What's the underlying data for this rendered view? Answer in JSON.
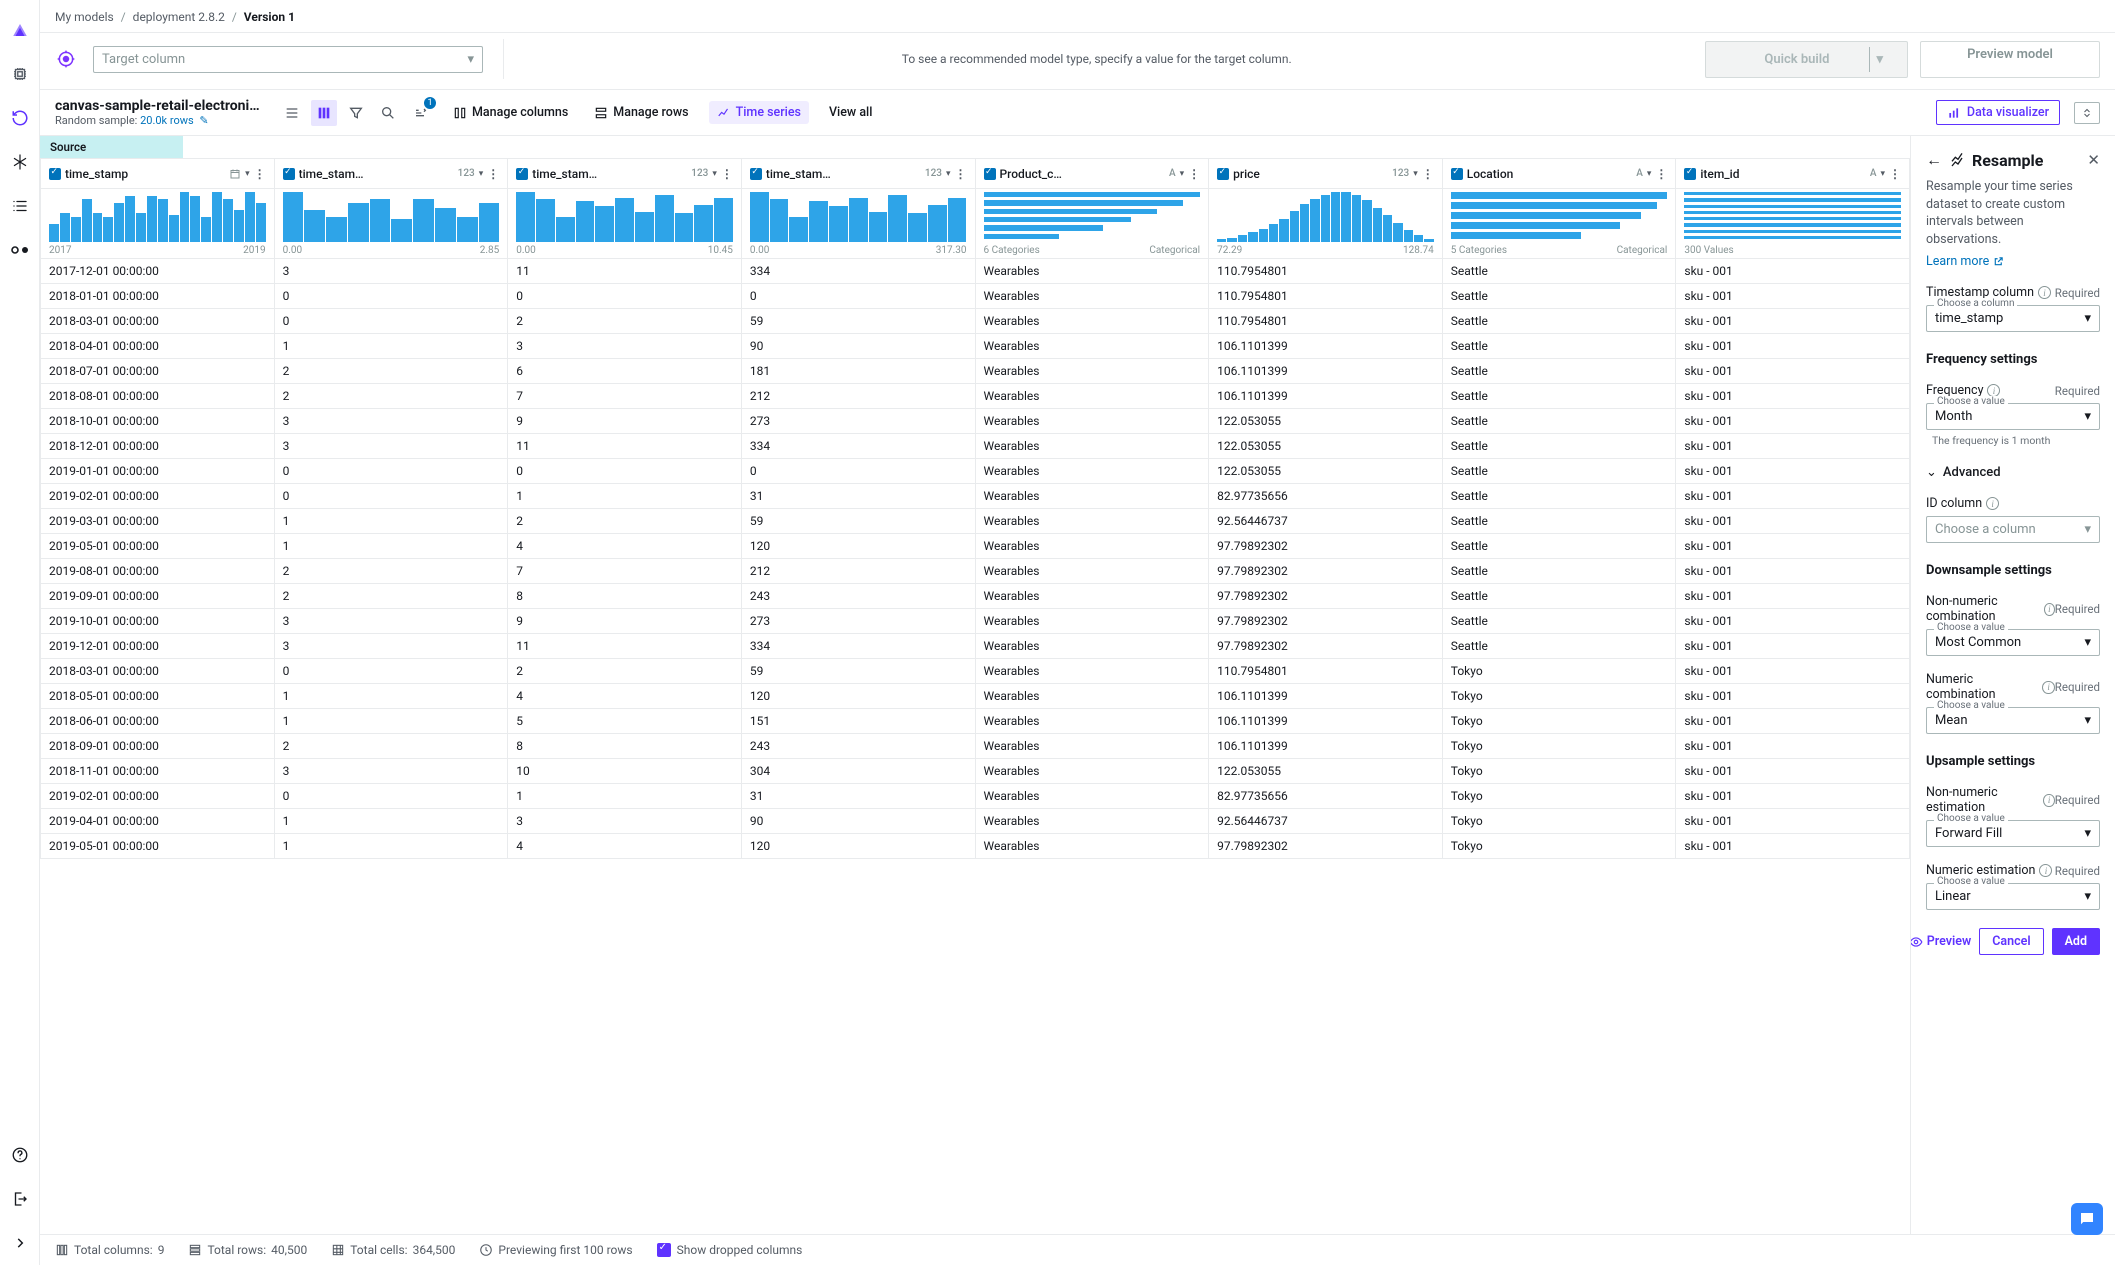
{
  "breadcrumb": {
    "parent1": "My models",
    "parent2": "deployment 2.8.2",
    "current": "Version 1"
  },
  "target": {
    "placeholder": "Target column",
    "help": "To see a recommended model type, specify a value for the target column."
  },
  "buttons": {
    "quick_build": "Quick build",
    "preview_model": "Preview model"
  },
  "dataset": {
    "name": "canvas-sample-retail-electronics-fore…",
    "sample_label": "Random sample:",
    "sample_value": "20.0k rows"
  },
  "toolbar": {
    "manage_columns": "Manage columns",
    "manage_rows": "Manage rows",
    "time_series": "Time series",
    "view_all": "View all",
    "data_visualizer": "Data visualizer",
    "badge": "1"
  },
  "source_tab": "Source",
  "columns": [
    {
      "name": "time_stamp",
      "type": "date",
      "meta_left": "2017",
      "meta_right": "2019",
      "hist": [
        25,
        40,
        35,
        60,
        40,
        35,
        55,
        65,
        40,
        65,
        60,
        38,
        70,
        65,
        35,
        70,
        60,
        45,
        70,
        55
      ]
    },
    {
      "name": "time_stam…",
      "type": "123",
      "meta_left": "0.00",
      "meta_right": "2.85",
      "hist": [
        70,
        45,
        35,
        55,
        60,
        32,
        60,
        48,
        35,
        55
      ]
    },
    {
      "name": "time_stam…",
      "type": "123",
      "meta_left": "0.00",
      "meta_right": "10.45",
      "hist": [
        70,
        60,
        35,
        58,
        50,
        62,
        42,
        66,
        40,
        52,
        62
      ]
    },
    {
      "name": "time_stam…",
      "type": "123",
      "meta_left": "0.00",
      "meta_right": "317.30",
      "hist": [
        70,
        60,
        35,
        58,
        50,
        62,
        42,
        66,
        40,
        52,
        62
      ]
    },
    {
      "name": "Product_c…",
      "type": "A",
      "meta_left": "6 Categories",
      "meta_right": "Categorical",
      "cat_bars": [
        100,
        92,
        80,
        68,
        55,
        35
      ]
    },
    {
      "name": "price",
      "type": "123",
      "meta_left": "72.29",
      "meta_right": "128.74",
      "hist": [
        5,
        8,
        12,
        18,
        24,
        32,
        42,
        55,
        68,
        78,
        85,
        90,
        90,
        85,
        75,
        62,
        48,
        35,
        22,
        12,
        6
      ]
    },
    {
      "name": "Location",
      "type": "A",
      "meta_left": "5 Categories",
      "meta_right": "Categorical",
      "cat_bars": [
        100,
        95,
        88,
        78,
        60
      ]
    },
    {
      "name": "item_id",
      "type": "A",
      "meta_left": "300 Values",
      "meta_right": "",
      "cat_bars": [
        8,
        8,
        8,
        8,
        8,
        8,
        8,
        8
      ]
    }
  ],
  "rows": [
    [
      "2017-12-01 00:00:00",
      "3",
      "11",
      "334",
      "Wearables",
      "110.7954801",
      "Seattle",
      "sku - 001"
    ],
    [
      "2018-01-01 00:00:00",
      "0",
      "0",
      "0",
      "Wearables",
      "110.7954801",
      "Seattle",
      "sku - 001"
    ],
    [
      "2018-03-01 00:00:00",
      "0",
      "2",
      "59",
      "Wearables",
      "110.7954801",
      "Seattle",
      "sku - 001"
    ],
    [
      "2018-04-01 00:00:00",
      "1",
      "3",
      "90",
      "Wearables",
      "106.1101399",
      "Seattle",
      "sku - 001"
    ],
    [
      "2018-07-01 00:00:00",
      "2",
      "6",
      "181",
      "Wearables",
      "106.1101399",
      "Seattle",
      "sku - 001"
    ],
    [
      "2018-08-01 00:00:00",
      "2",
      "7",
      "212",
      "Wearables",
      "106.1101399",
      "Seattle",
      "sku - 001"
    ],
    [
      "2018-10-01 00:00:00",
      "3",
      "9",
      "273",
      "Wearables",
      "122.053055",
      "Seattle",
      "sku - 001"
    ],
    [
      "2018-12-01 00:00:00",
      "3",
      "11",
      "334",
      "Wearables",
      "122.053055",
      "Seattle",
      "sku - 001"
    ],
    [
      "2019-01-01 00:00:00",
      "0",
      "0",
      "0",
      "Wearables",
      "122.053055",
      "Seattle",
      "sku - 001"
    ],
    [
      "2019-02-01 00:00:00",
      "0",
      "1",
      "31",
      "Wearables",
      "82.97735656",
      "Seattle",
      "sku - 001"
    ],
    [
      "2019-03-01 00:00:00",
      "1",
      "2",
      "59",
      "Wearables",
      "92.56446737",
      "Seattle",
      "sku - 001"
    ],
    [
      "2019-05-01 00:00:00",
      "1",
      "4",
      "120",
      "Wearables",
      "97.79892302",
      "Seattle",
      "sku - 001"
    ],
    [
      "2019-08-01 00:00:00",
      "2",
      "7",
      "212",
      "Wearables",
      "97.79892302",
      "Seattle",
      "sku - 001"
    ],
    [
      "2019-09-01 00:00:00",
      "2",
      "8",
      "243",
      "Wearables",
      "97.79892302",
      "Seattle",
      "sku - 001"
    ],
    [
      "2019-10-01 00:00:00",
      "3",
      "9",
      "273",
      "Wearables",
      "97.79892302",
      "Seattle",
      "sku - 001"
    ],
    [
      "2019-12-01 00:00:00",
      "3",
      "11",
      "334",
      "Wearables",
      "97.79892302",
      "Seattle",
      "sku - 001"
    ],
    [
      "2018-03-01 00:00:00",
      "0",
      "2",
      "59",
      "Wearables",
      "110.7954801",
      "Tokyo",
      "sku - 001"
    ],
    [
      "2018-05-01 00:00:00",
      "1",
      "4",
      "120",
      "Wearables",
      "106.1101399",
      "Tokyo",
      "sku - 001"
    ],
    [
      "2018-06-01 00:00:00",
      "1",
      "5",
      "151",
      "Wearables",
      "106.1101399",
      "Tokyo",
      "sku - 001"
    ],
    [
      "2018-09-01 00:00:00",
      "2",
      "8",
      "243",
      "Wearables",
      "106.1101399",
      "Tokyo",
      "sku - 001"
    ],
    [
      "2018-11-01 00:00:00",
      "3",
      "10",
      "304",
      "Wearables",
      "122.053055",
      "Tokyo",
      "sku - 001"
    ],
    [
      "2019-02-01 00:00:00",
      "0",
      "1",
      "31",
      "Wearables",
      "82.97735656",
      "Tokyo",
      "sku - 001"
    ],
    [
      "2019-04-01 00:00:00",
      "1",
      "3",
      "90",
      "Wearables",
      "92.56446737",
      "Tokyo",
      "sku - 001"
    ],
    [
      "2019-05-01 00:00:00",
      "1",
      "4",
      "120",
      "Wearables",
      "97.79892302",
      "Tokyo",
      "sku - 001"
    ]
  ],
  "footer": {
    "cols_label": "Total columns:",
    "cols_val": "9",
    "rows_label": "Total rows:",
    "rows_val": "40,500",
    "cells_label": "Total cells:",
    "cells_val": "364,500",
    "preview_label": "Previewing first 100 rows",
    "show_dropped": "Show dropped columns"
  },
  "panel": {
    "title": "Resample",
    "desc": "Resample your time series dataset to create custom intervals between observations.",
    "learn_more": "Learn more",
    "timestamp_label": "Timestamp column",
    "required": "Required",
    "choose_column": "Choose a column",
    "timestamp_value": "time_stamp",
    "freq_settings": "Frequency settings",
    "freq_label": "Frequency",
    "choose_value": "Choose a value",
    "freq_value": "Month",
    "freq_hint": "The frequency is 1 month",
    "advanced": "Advanced",
    "id_label": "ID column",
    "id_placeholder": "Choose a column",
    "down_settings": "Downsample settings",
    "nonnum_comb": "Non-numeric combination",
    "nonnum_comb_val": "Most Common",
    "num_comb": "Numeric combination",
    "num_comb_val": "Mean",
    "up_settings": "Upsample settings",
    "nonnum_est": "Non-numeric estimation",
    "nonnum_est_val": "Forward Fill",
    "num_est": "Numeric estimation",
    "num_est_val": "Linear",
    "preview": "Preview",
    "cancel": "Cancel",
    "add": "Add"
  }
}
